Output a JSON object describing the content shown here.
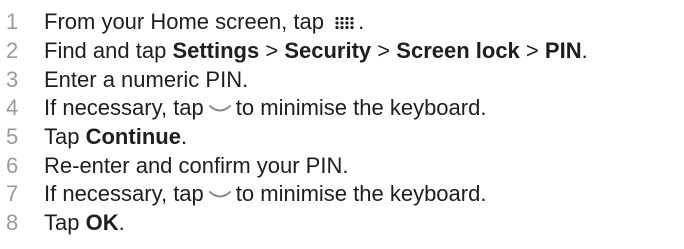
{
  "steps": [
    {
      "num": "1",
      "t1": "From your Home screen, tap",
      "t2": "."
    },
    {
      "num": "2",
      "t1": "Find and tap",
      "k1": "Settings",
      "s1": ">",
      "k2": "Security",
      "s2": ">",
      "k3": "Screen lock",
      "s3": ">",
      "k4": "PIN",
      "t2": "."
    },
    {
      "num": "3",
      "t1": "Enter a numeric PIN."
    },
    {
      "num": "4",
      "t1": "If necessary, tap",
      "t2": "to minimise the keyboard."
    },
    {
      "num": "5",
      "t1": "Tap",
      "k1": "Continue",
      "t2": "."
    },
    {
      "num": "6",
      "t1": "Re-enter and confirm your PIN."
    },
    {
      "num": "7",
      "t1": "If necessary, tap",
      "t2": "to minimise the keyboard."
    },
    {
      "num": "8",
      "t1": "Tap",
      "k1": "OK",
      "t2": "."
    }
  ],
  "icons": {
    "grid": "app-grid-icon",
    "chevron": "chevron-down-icon"
  },
  "colors": {
    "text": "#1e1e1e",
    "step_number": "#9a9a9a"
  }
}
